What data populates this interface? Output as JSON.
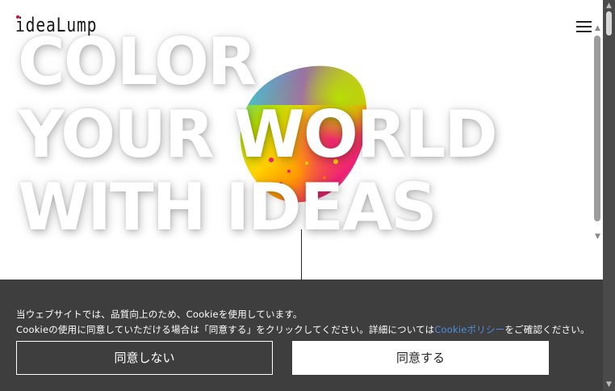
{
  "header": {
    "logo_text": "ideaLump",
    "logo_accent_color": "#d0103a",
    "menu_icon": "hamburger-menu-icon"
  },
  "hero": {
    "line1": "COLOR",
    "line2": "YOUR WORLD",
    "line3": "WITH IDEAS",
    "blob_colors": [
      "#2ec4f0",
      "#b7e000",
      "#ffd400",
      "#ff6a1a",
      "#ee1f7a",
      "#8f4fd6"
    ]
  },
  "cookie": {
    "line1": "当ウェブサイトでは、品質向上のため、Cookieを使用しています。",
    "line2_before_link": "Cookieの使用に同意していただける場合は「同意する」をクリックしてください。詳細については",
    "link_text": "Cookieポリシー",
    "line2_after_link": "をご確認ください。",
    "decline_label": "同意しない",
    "accept_label": "同意する",
    "link_color": "#4d8fdf",
    "background_color": "#3e3e3e"
  }
}
